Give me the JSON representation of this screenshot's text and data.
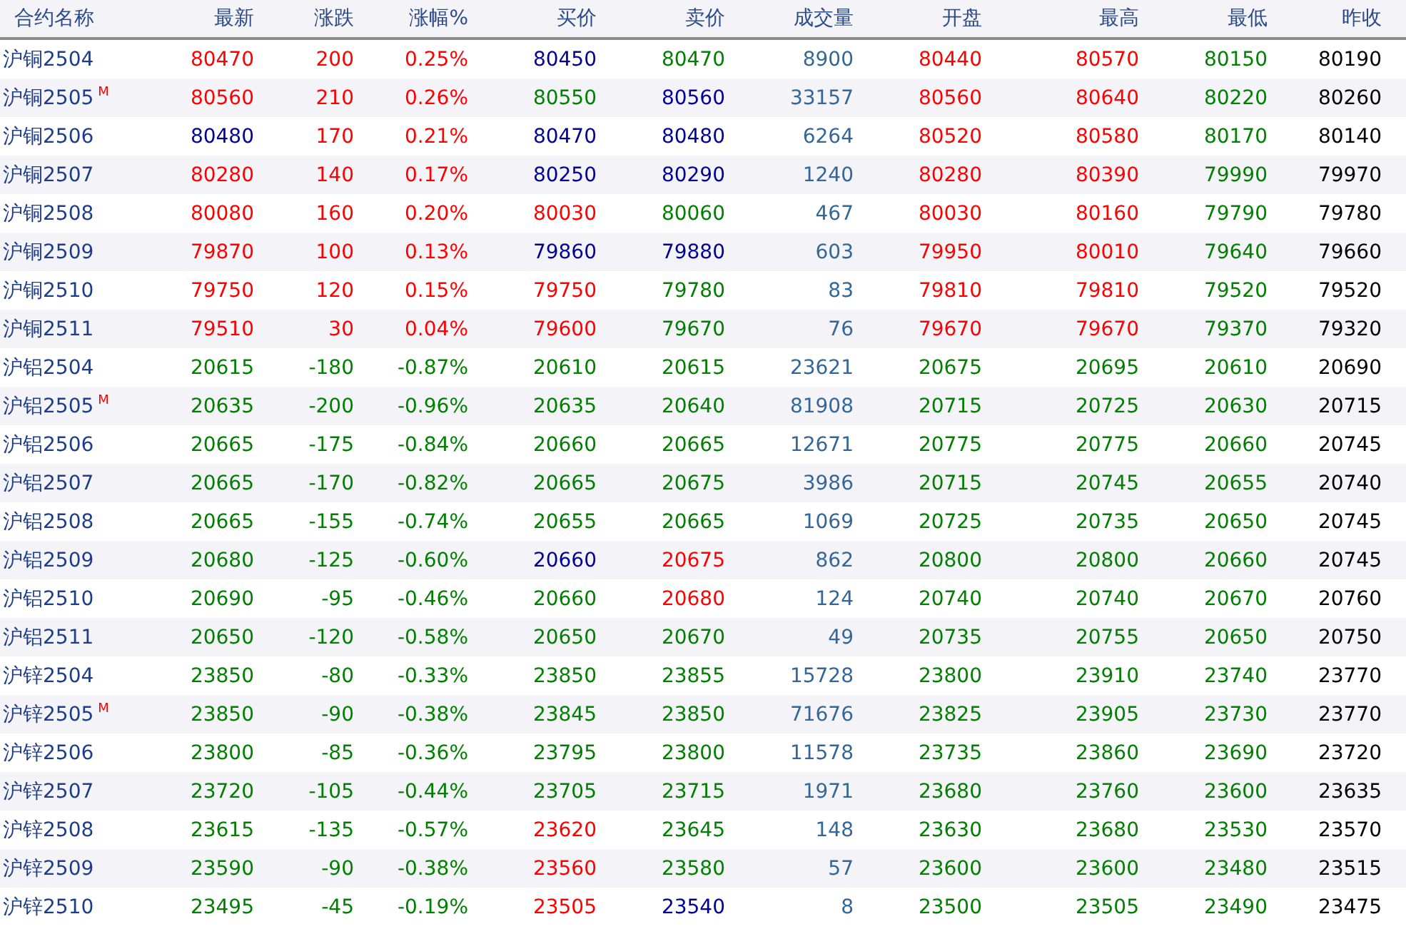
{
  "table": {
    "columns": [
      "合约名称",
      "最新",
      "涨跌",
      "涨幅%",
      "买价",
      "卖价",
      "成交量",
      "开盘",
      "最高",
      "最低",
      "昨收"
    ],
    "rows": [
      {
        "cells": [
          {
            "text": "沪铜2504"
          },
          {
            "text": "80470",
            "color": "#ff0000"
          },
          {
            "text": "200",
            "color": "#ff0000"
          },
          {
            "text": "0.25%",
            "color": "#ff0000"
          },
          {
            "text": "80450",
            "color": "#000099"
          },
          {
            "text": "80470",
            "color": "#008000"
          },
          {
            "text": "8900",
            "color": "#336699"
          },
          {
            "text": "80440",
            "color": "#ff0000"
          },
          {
            "text": "80570",
            "color": "#ff0000"
          },
          {
            "text": "80150",
            "color": "#008000"
          },
          {
            "text": "80190",
            "color": "#000000"
          }
        ]
      },
      {
        "cells": [
          {
            "text": "沪铜2505",
            "badge": "M"
          },
          {
            "text": "80560",
            "color": "#ff0000"
          },
          {
            "text": "210",
            "color": "#ff0000"
          },
          {
            "text": "0.26%",
            "color": "#ff0000"
          },
          {
            "text": "80550",
            "color": "#008000"
          },
          {
            "text": "80560",
            "color": "#000099"
          },
          {
            "text": "33157",
            "color": "#336699"
          },
          {
            "text": "80560",
            "color": "#ff0000"
          },
          {
            "text": "80640",
            "color": "#ff0000"
          },
          {
            "text": "80220",
            "color": "#008000"
          },
          {
            "text": "80260",
            "color": "#000000"
          }
        ]
      },
      {
        "cells": [
          {
            "text": "沪铜2506"
          },
          {
            "text": "80480",
            "color": "#000099"
          },
          {
            "text": "170",
            "color": "#ff0000"
          },
          {
            "text": "0.21%",
            "color": "#ff0000"
          },
          {
            "text": "80470",
            "color": "#000099"
          },
          {
            "text": "80480",
            "color": "#000099"
          },
          {
            "text": "6264",
            "color": "#336699"
          },
          {
            "text": "80520",
            "color": "#ff0000"
          },
          {
            "text": "80580",
            "color": "#ff0000"
          },
          {
            "text": "80170",
            "color": "#008000"
          },
          {
            "text": "80140",
            "color": "#000000"
          }
        ]
      },
      {
        "cells": [
          {
            "text": "沪铜2507"
          },
          {
            "text": "80280",
            "color": "#ff0000"
          },
          {
            "text": "140",
            "color": "#ff0000"
          },
          {
            "text": "0.17%",
            "color": "#ff0000"
          },
          {
            "text": "80250",
            "color": "#000099"
          },
          {
            "text": "80290",
            "color": "#000099"
          },
          {
            "text": "1240",
            "color": "#336699"
          },
          {
            "text": "80280",
            "color": "#ff0000"
          },
          {
            "text": "80390",
            "color": "#ff0000"
          },
          {
            "text": "79990",
            "color": "#008000"
          },
          {
            "text": "79970",
            "color": "#000000"
          }
        ]
      },
      {
        "cells": [
          {
            "text": "沪铜2508"
          },
          {
            "text": "80080",
            "color": "#ff0000"
          },
          {
            "text": "160",
            "color": "#ff0000"
          },
          {
            "text": "0.20%",
            "color": "#ff0000"
          },
          {
            "text": "80030",
            "color": "#ff0000"
          },
          {
            "text": "80060",
            "color": "#008000"
          },
          {
            "text": "467",
            "color": "#336699"
          },
          {
            "text": "80030",
            "color": "#ff0000"
          },
          {
            "text": "80160",
            "color": "#ff0000"
          },
          {
            "text": "79790",
            "color": "#008000"
          },
          {
            "text": "79780",
            "color": "#000000"
          }
        ]
      },
      {
        "cells": [
          {
            "text": "沪铜2509"
          },
          {
            "text": "79870",
            "color": "#ff0000"
          },
          {
            "text": "100",
            "color": "#ff0000"
          },
          {
            "text": "0.13%",
            "color": "#ff0000"
          },
          {
            "text": "79860",
            "color": "#000099"
          },
          {
            "text": "79880",
            "color": "#000099"
          },
          {
            "text": "603",
            "color": "#336699"
          },
          {
            "text": "79950",
            "color": "#ff0000"
          },
          {
            "text": "80010",
            "color": "#ff0000"
          },
          {
            "text": "79640",
            "color": "#008000"
          },
          {
            "text": "79660",
            "color": "#000000"
          }
        ]
      },
      {
        "cells": [
          {
            "text": "沪铜2510"
          },
          {
            "text": "79750",
            "color": "#ff0000"
          },
          {
            "text": "120",
            "color": "#ff0000"
          },
          {
            "text": "0.15%",
            "color": "#ff0000"
          },
          {
            "text": "79750",
            "color": "#ff0000"
          },
          {
            "text": "79780",
            "color": "#008000"
          },
          {
            "text": "83",
            "color": "#336699"
          },
          {
            "text": "79810",
            "color": "#ff0000"
          },
          {
            "text": "79810",
            "color": "#ff0000"
          },
          {
            "text": "79520",
            "color": "#008000"
          },
          {
            "text": "79520",
            "color": "#000000"
          }
        ]
      },
      {
        "cells": [
          {
            "text": "沪铜2511"
          },
          {
            "text": "79510",
            "color": "#ff0000"
          },
          {
            "text": "30",
            "color": "#ff0000"
          },
          {
            "text": "0.04%",
            "color": "#ff0000"
          },
          {
            "text": "79600",
            "color": "#ff0000"
          },
          {
            "text": "79670",
            "color": "#008000"
          },
          {
            "text": "76",
            "color": "#336699"
          },
          {
            "text": "79670",
            "color": "#ff0000"
          },
          {
            "text": "79670",
            "color": "#ff0000"
          },
          {
            "text": "79370",
            "color": "#008000"
          },
          {
            "text": "79320",
            "color": "#000000"
          }
        ]
      },
      {
        "cells": [
          {
            "text": "沪铝2504"
          },
          {
            "text": "20615",
            "color": "#008000"
          },
          {
            "text": "-180",
            "color": "#008000"
          },
          {
            "text": "-0.87%",
            "color": "#008000"
          },
          {
            "text": "20610",
            "color": "#008000"
          },
          {
            "text": "20615",
            "color": "#008000"
          },
          {
            "text": "23621",
            "color": "#336699"
          },
          {
            "text": "20675",
            "color": "#008000"
          },
          {
            "text": "20695",
            "color": "#008000"
          },
          {
            "text": "20610",
            "color": "#008000"
          },
          {
            "text": "20690",
            "color": "#000000"
          }
        ]
      },
      {
        "cells": [
          {
            "text": "沪铝2505",
            "badge": "M"
          },
          {
            "text": "20635",
            "color": "#008000"
          },
          {
            "text": "-200",
            "color": "#008000"
          },
          {
            "text": "-0.96%",
            "color": "#008000"
          },
          {
            "text": "20635",
            "color": "#008000"
          },
          {
            "text": "20640",
            "color": "#008000"
          },
          {
            "text": "81908",
            "color": "#336699"
          },
          {
            "text": "20715",
            "color": "#008000"
          },
          {
            "text": "20725",
            "color": "#008000"
          },
          {
            "text": "20630",
            "color": "#008000"
          },
          {
            "text": "20715",
            "color": "#000000"
          }
        ]
      },
      {
        "cells": [
          {
            "text": "沪铝2506"
          },
          {
            "text": "20665",
            "color": "#008000"
          },
          {
            "text": "-175",
            "color": "#008000"
          },
          {
            "text": "-0.84%",
            "color": "#008000"
          },
          {
            "text": "20660",
            "color": "#008000"
          },
          {
            "text": "20665",
            "color": "#008000"
          },
          {
            "text": "12671",
            "color": "#336699"
          },
          {
            "text": "20775",
            "color": "#008000"
          },
          {
            "text": "20775",
            "color": "#008000"
          },
          {
            "text": "20660",
            "color": "#008000"
          },
          {
            "text": "20745",
            "color": "#000000"
          }
        ]
      },
      {
        "cells": [
          {
            "text": "沪铝2507"
          },
          {
            "text": "20665",
            "color": "#008000"
          },
          {
            "text": "-170",
            "color": "#008000"
          },
          {
            "text": "-0.82%",
            "color": "#008000"
          },
          {
            "text": "20665",
            "color": "#008000"
          },
          {
            "text": "20675",
            "color": "#008000"
          },
          {
            "text": "3986",
            "color": "#336699"
          },
          {
            "text": "20715",
            "color": "#008000"
          },
          {
            "text": "20745",
            "color": "#008000"
          },
          {
            "text": "20655",
            "color": "#008000"
          },
          {
            "text": "20740",
            "color": "#000000"
          }
        ]
      },
      {
        "cells": [
          {
            "text": "沪铝2508"
          },
          {
            "text": "20665",
            "color": "#008000"
          },
          {
            "text": "-155",
            "color": "#008000"
          },
          {
            "text": "-0.74%",
            "color": "#008000"
          },
          {
            "text": "20655",
            "color": "#008000"
          },
          {
            "text": "20665",
            "color": "#008000"
          },
          {
            "text": "1069",
            "color": "#336699"
          },
          {
            "text": "20725",
            "color": "#008000"
          },
          {
            "text": "20735",
            "color": "#008000"
          },
          {
            "text": "20650",
            "color": "#008000"
          },
          {
            "text": "20745",
            "color": "#000000"
          }
        ]
      },
      {
        "cells": [
          {
            "text": "沪铝2509"
          },
          {
            "text": "20680",
            "color": "#008000"
          },
          {
            "text": "-125",
            "color": "#008000"
          },
          {
            "text": "-0.60%",
            "color": "#008000"
          },
          {
            "text": "20660",
            "color": "#000099"
          },
          {
            "text": "20675",
            "color": "#ff0000"
          },
          {
            "text": "862",
            "color": "#336699"
          },
          {
            "text": "20800",
            "color": "#008000"
          },
          {
            "text": "20800",
            "color": "#008000"
          },
          {
            "text": "20660",
            "color": "#008000"
          },
          {
            "text": "20745",
            "color": "#000000"
          }
        ]
      },
      {
        "cells": [
          {
            "text": "沪铝2510"
          },
          {
            "text": "20690",
            "color": "#008000"
          },
          {
            "text": "-95",
            "color": "#008000"
          },
          {
            "text": "-0.46%",
            "color": "#008000"
          },
          {
            "text": "20660",
            "color": "#008000"
          },
          {
            "text": "20680",
            "color": "#ff0000"
          },
          {
            "text": "124",
            "color": "#336699"
          },
          {
            "text": "20740",
            "color": "#008000"
          },
          {
            "text": "20740",
            "color": "#008000"
          },
          {
            "text": "20670",
            "color": "#008000"
          },
          {
            "text": "20760",
            "color": "#000000"
          }
        ]
      },
      {
        "cells": [
          {
            "text": "沪铝2511"
          },
          {
            "text": "20650",
            "color": "#008000"
          },
          {
            "text": "-120",
            "color": "#008000"
          },
          {
            "text": "-0.58%",
            "color": "#008000"
          },
          {
            "text": "20650",
            "color": "#008000"
          },
          {
            "text": "20670",
            "color": "#008000"
          },
          {
            "text": "49",
            "color": "#336699"
          },
          {
            "text": "20735",
            "color": "#008000"
          },
          {
            "text": "20755",
            "color": "#008000"
          },
          {
            "text": "20650",
            "color": "#008000"
          },
          {
            "text": "20750",
            "color": "#000000"
          }
        ]
      },
      {
        "cells": [
          {
            "text": "沪锌2504"
          },
          {
            "text": "23850",
            "color": "#008000"
          },
          {
            "text": "-80",
            "color": "#008000"
          },
          {
            "text": "-0.33%",
            "color": "#008000"
          },
          {
            "text": "23850",
            "color": "#008000"
          },
          {
            "text": "23855",
            "color": "#008000"
          },
          {
            "text": "15728",
            "color": "#336699"
          },
          {
            "text": "23800",
            "color": "#008000"
          },
          {
            "text": "23910",
            "color": "#008000"
          },
          {
            "text": "23740",
            "color": "#008000"
          },
          {
            "text": "23770",
            "color": "#000000"
          }
        ]
      },
      {
        "cells": [
          {
            "text": "沪锌2505",
            "badge": "M"
          },
          {
            "text": "23850",
            "color": "#008000"
          },
          {
            "text": "-90",
            "color": "#008000"
          },
          {
            "text": "-0.38%",
            "color": "#008000"
          },
          {
            "text": "23845",
            "color": "#008000"
          },
          {
            "text": "23850",
            "color": "#008000"
          },
          {
            "text": "71676",
            "color": "#336699"
          },
          {
            "text": "23825",
            "color": "#008000"
          },
          {
            "text": "23905",
            "color": "#008000"
          },
          {
            "text": "23730",
            "color": "#008000"
          },
          {
            "text": "23770",
            "color": "#000000"
          }
        ]
      },
      {
        "cells": [
          {
            "text": "沪锌2506"
          },
          {
            "text": "23800",
            "color": "#008000"
          },
          {
            "text": "-85",
            "color": "#008000"
          },
          {
            "text": "-0.36%",
            "color": "#008000"
          },
          {
            "text": "23795",
            "color": "#008000"
          },
          {
            "text": "23800",
            "color": "#008000"
          },
          {
            "text": "11578",
            "color": "#336699"
          },
          {
            "text": "23735",
            "color": "#008000"
          },
          {
            "text": "23860",
            "color": "#008000"
          },
          {
            "text": "23690",
            "color": "#008000"
          },
          {
            "text": "23720",
            "color": "#000000"
          }
        ]
      },
      {
        "cells": [
          {
            "text": "沪锌2507"
          },
          {
            "text": "23720",
            "color": "#008000"
          },
          {
            "text": "-105",
            "color": "#008000"
          },
          {
            "text": "-0.44%",
            "color": "#008000"
          },
          {
            "text": "23705",
            "color": "#008000"
          },
          {
            "text": "23715",
            "color": "#008000"
          },
          {
            "text": "1971",
            "color": "#336699"
          },
          {
            "text": "23680",
            "color": "#008000"
          },
          {
            "text": "23760",
            "color": "#008000"
          },
          {
            "text": "23600",
            "color": "#008000"
          },
          {
            "text": "23635",
            "color": "#000000"
          }
        ]
      },
      {
        "cells": [
          {
            "text": "沪锌2508"
          },
          {
            "text": "23615",
            "color": "#008000"
          },
          {
            "text": "-135",
            "color": "#008000"
          },
          {
            "text": "-0.57%",
            "color": "#008000"
          },
          {
            "text": "23620",
            "color": "#ff0000"
          },
          {
            "text": "23645",
            "color": "#008000"
          },
          {
            "text": "148",
            "color": "#336699"
          },
          {
            "text": "23630",
            "color": "#008000"
          },
          {
            "text": "23680",
            "color": "#008000"
          },
          {
            "text": "23530",
            "color": "#008000"
          },
          {
            "text": "23570",
            "color": "#000000"
          }
        ]
      },
      {
        "cells": [
          {
            "text": "沪锌2509"
          },
          {
            "text": "23590",
            "color": "#008000"
          },
          {
            "text": "-90",
            "color": "#008000"
          },
          {
            "text": "-0.38%",
            "color": "#008000"
          },
          {
            "text": "23560",
            "color": "#ff0000"
          },
          {
            "text": "23580",
            "color": "#008000"
          },
          {
            "text": "57",
            "color": "#336699"
          },
          {
            "text": "23600",
            "color": "#008000"
          },
          {
            "text": "23600",
            "color": "#008000"
          },
          {
            "text": "23480",
            "color": "#008000"
          },
          {
            "text": "23515",
            "color": "#000000"
          }
        ]
      },
      {
        "cells": [
          {
            "text": "沪锌2510"
          },
          {
            "text": "23495",
            "color": "#008000"
          },
          {
            "text": "-45",
            "color": "#008000"
          },
          {
            "text": "-0.19%",
            "color": "#008000"
          },
          {
            "text": "23505",
            "color": "#ff0000"
          },
          {
            "text": "23540",
            "color": "#000099"
          },
          {
            "text": "8",
            "color": "#336699"
          },
          {
            "text": "23500",
            "color": "#008000"
          },
          {
            "text": "23505",
            "color": "#008000"
          },
          {
            "text": "23490",
            "color": "#008000"
          },
          {
            "text": "23475",
            "color": "#000000"
          }
        ]
      }
    ]
  }
}
